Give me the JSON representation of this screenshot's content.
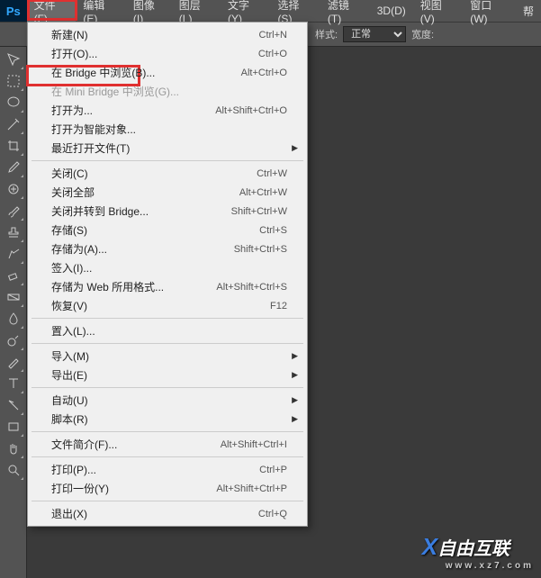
{
  "app": {
    "logo": "Ps"
  },
  "menubar": [
    {
      "label": "文件(F)",
      "active": true
    },
    {
      "label": "编辑(E)"
    },
    {
      "label": "图像(I)"
    },
    {
      "label": "图层(L)"
    },
    {
      "label": "文字(Y)"
    },
    {
      "label": "选择(S)"
    },
    {
      "label": "滤镜(T)"
    },
    {
      "label": "3D(D)"
    },
    {
      "label": "视图(V)"
    },
    {
      "label": "窗口(W)"
    },
    {
      "label": "帮"
    }
  ],
  "options": {
    "style_label": "样式:",
    "style_value": "正常",
    "width_label": "宽度:"
  },
  "file_menu": [
    {
      "type": "item",
      "label": "新建(N)",
      "shortcut": "Ctrl+N"
    },
    {
      "type": "item",
      "label": "打开(O)...",
      "shortcut": "Ctrl+O"
    },
    {
      "type": "item",
      "label": "在 Bridge 中浏览(B)...",
      "shortcut": "Alt+Ctrl+O"
    },
    {
      "type": "item",
      "label": "在 Mini Bridge 中浏览(G)...",
      "disabled": true
    },
    {
      "type": "item",
      "label": "打开为...",
      "shortcut": "Alt+Shift+Ctrl+O"
    },
    {
      "type": "item",
      "label": "打开为智能对象..."
    },
    {
      "type": "item",
      "label": "最近打开文件(T)",
      "submenu": true
    },
    {
      "type": "sep"
    },
    {
      "type": "item",
      "label": "关闭(C)",
      "shortcut": "Ctrl+W"
    },
    {
      "type": "item",
      "label": "关闭全部",
      "shortcut": "Alt+Ctrl+W"
    },
    {
      "type": "item",
      "label": "关闭并转到 Bridge...",
      "shortcut": "Shift+Ctrl+W"
    },
    {
      "type": "item",
      "label": "存储(S)",
      "shortcut": "Ctrl+S"
    },
    {
      "type": "item",
      "label": "存储为(A)...",
      "shortcut": "Shift+Ctrl+S"
    },
    {
      "type": "item",
      "label": "签入(I)..."
    },
    {
      "type": "item",
      "label": "存储为 Web 所用格式...",
      "shortcut": "Alt+Shift+Ctrl+S"
    },
    {
      "type": "item",
      "label": "恢复(V)",
      "shortcut": "F12"
    },
    {
      "type": "sep"
    },
    {
      "type": "item",
      "label": "置入(L)..."
    },
    {
      "type": "sep"
    },
    {
      "type": "item",
      "label": "导入(M)",
      "submenu": true
    },
    {
      "type": "item",
      "label": "导出(E)",
      "submenu": true
    },
    {
      "type": "sep"
    },
    {
      "type": "item",
      "label": "自动(U)",
      "submenu": true
    },
    {
      "type": "item",
      "label": "脚本(R)",
      "submenu": true
    },
    {
      "type": "sep"
    },
    {
      "type": "item",
      "label": "文件简介(F)...",
      "shortcut": "Alt+Shift+Ctrl+I"
    },
    {
      "type": "sep"
    },
    {
      "type": "item",
      "label": "打印(P)...",
      "shortcut": "Ctrl+P"
    },
    {
      "type": "item",
      "label": "打印一份(Y)",
      "shortcut": "Alt+Shift+Ctrl+P"
    },
    {
      "type": "sep"
    },
    {
      "type": "item",
      "label": "退出(X)",
      "shortcut": "Ctrl+Q"
    }
  ],
  "tools": [
    "move",
    "marquee",
    "lasso",
    "wand",
    "crop",
    "eyedrop",
    "heal",
    "brush",
    "stamp",
    "history",
    "eraser",
    "gradient",
    "blur",
    "dodge",
    "pen",
    "type",
    "path",
    "rect",
    "hand",
    "zoom"
  ],
  "watermark": {
    "brand": "自由互联",
    "sub": "www.xz7.com"
  }
}
